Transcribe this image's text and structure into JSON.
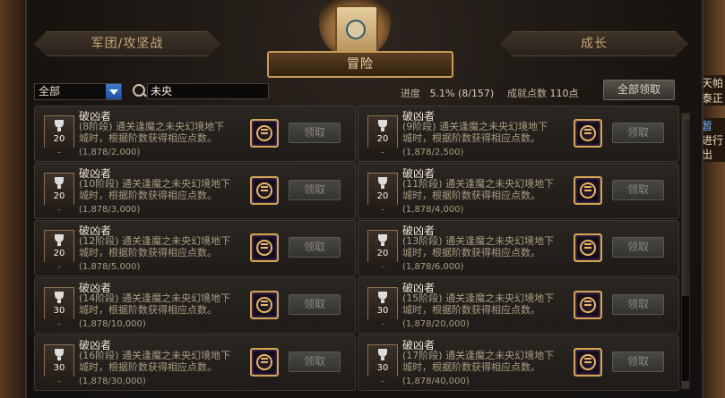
{
  "tabs": {
    "left": "军团/攻坚战",
    "center": "冒险",
    "right": "成长"
  },
  "filter": {
    "selected": "全部"
  },
  "search": {
    "value": "未央"
  },
  "stats": {
    "progress_label": "进度",
    "progress_value": "5.1% (8/157)",
    "points_label": "成就点数",
    "points_value": "110点"
  },
  "claim_all_label": "全部领取",
  "background_right": [
    "天帕",
    "泰正",
    "暂",
    "进行",
    "出"
  ],
  "cards": [
    {
      "title": "破凶者",
      "phase": "(8阶段)",
      "desc1": "通关逢魔之未央幻境地下",
      "desc2": "城时，根据阶数获得相应点数。",
      "progress": "(1,878/2,000)",
      "points": "20",
      "claim": "领取"
    },
    {
      "title": "破凶者",
      "phase": "(9阶段)",
      "desc1": "通关逢魔之未央幻境地下",
      "desc2": "城时，根据阶数获得相应点数。",
      "progress": "(1,878/2,500)",
      "points": "20",
      "claim": "领取"
    },
    {
      "title": "破凶者",
      "phase": "(10阶段)",
      "desc1": "通关逢魔之未央幻境地下",
      "desc2": "城时，根据阶数获得相应点数。",
      "progress": "(1,878/3,000)",
      "points": "20",
      "claim": "领取"
    },
    {
      "title": "破凶者",
      "phase": "(11阶段)",
      "desc1": "通关逢魔之未央幻境地下",
      "desc2": "城时，根据阶数获得相应点数。",
      "progress": "(1,878/4,000)",
      "points": "20",
      "claim": "领取"
    },
    {
      "title": "破凶者",
      "phase": "(12阶段)",
      "desc1": "通关逢魔之未央幻境地下",
      "desc2": "城时，根据阶数获得相应点数。",
      "progress": "(1,878/5,000)",
      "points": "20",
      "claim": "领取"
    },
    {
      "title": "破凶者",
      "phase": "(13阶段)",
      "desc1": "通关逢魔之未央幻境地下",
      "desc2": "城时，根据阶数获得相应点数。",
      "progress": "(1,878/6,000)",
      "points": "20",
      "claim": "领取"
    },
    {
      "title": "破凶者",
      "phase": "(14阶段)",
      "desc1": "通关逢魔之未央幻境地下",
      "desc2": "城时，根据阶数获得相应点数。",
      "progress": "(1,878/10,000)",
      "points": "30",
      "claim": "领取"
    },
    {
      "title": "破凶者",
      "phase": "(15阶段)",
      "desc1": "通关逢魔之未央幻境地下",
      "desc2": "城时，根据阶数获得相应点数。",
      "progress": "(1,878/20,000)",
      "points": "30",
      "claim": "领取"
    },
    {
      "title": "破凶者",
      "phase": "(16阶段)",
      "desc1": "通关逢魔之未央幻境地下",
      "desc2": "城时，根据阶数获得相应点数。",
      "progress": "(1,878/30,000)",
      "points": "30",
      "claim": "领取"
    },
    {
      "title": "破凶者",
      "phase": "(17阶段)",
      "desc1": "通关逢魔之未央幻境地下",
      "desc2": "城时，根据阶数获得相应点数。",
      "progress": "(1,878/40,000)",
      "points": "30",
      "claim": "领取"
    }
  ]
}
